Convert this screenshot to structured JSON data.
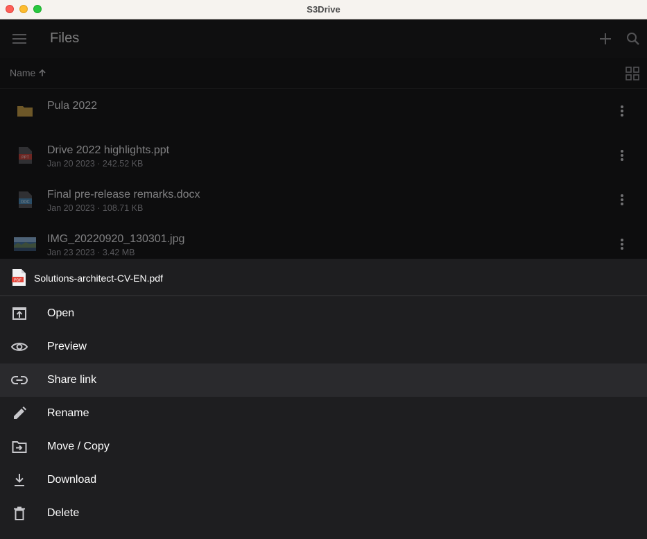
{
  "window": {
    "title": "S3Drive"
  },
  "appbar": {
    "title": "Files"
  },
  "sortbar": {
    "sort_label": "Name"
  },
  "files": [
    {
      "name": "Pula 2022",
      "meta": "",
      "type": "folder-icon"
    },
    {
      "name": "Drive 2022 highlights.ppt",
      "meta": "Jan 20 2023 · 242.52 KB",
      "type": "ppt-file-icon",
      "badge": "PPT"
    },
    {
      "name": "Final pre-release remarks.docx",
      "meta": "Jan 20 2023 · 108.71 KB",
      "type": "doc-file-icon",
      "badge": "DOC"
    },
    {
      "name": "IMG_20220920_130301.jpg",
      "meta": "Jan 23 2023 · 3.42 MB",
      "type": "image-thumbnail"
    }
  ],
  "sheet": {
    "file_name": "Solutions-architect-CV-EN.pdf",
    "file_badge": "PDF",
    "actions": [
      {
        "label": "Open",
        "icon": "open-in-icon"
      },
      {
        "label": "Preview",
        "icon": "eye-icon"
      },
      {
        "label": "Share link",
        "icon": "link-icon"
      },
      {
        "label": "Rename",
        "icon": "pencil-icon"
      },
      {
        "label": "Move / Copy",
        "icon": "folder-move-icon"
      },
      {
        "label": "Download",
        "icon": "download-icon"
      },
      {
        "label": "Delete",
        "icon": "trash-icon"
      }
    ]
  },
  "colors": {
    "ppt": "#c9473f",
    "doc": "#4f8fbf",
    "pdf": "#e0453a",
    "folder": "#c9a24a"
  }
}
